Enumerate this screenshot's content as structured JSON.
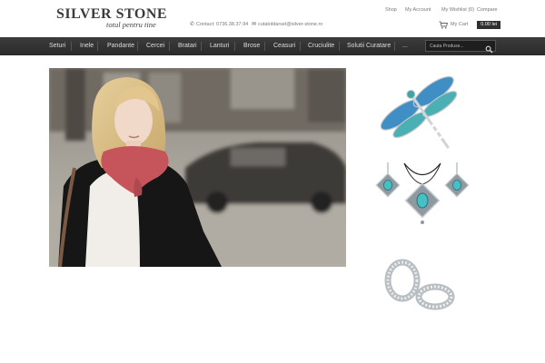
{
  "brand": {
    "name": "SILVER STONE",
    "tagline": "totul pentru tine"
  },
  "header": {
    "contact_phone": "Contact: 0736.38.37.94",
    "contact_email": "cutatoldarsel@silver-stone.ro",
    "top_links": [
      "Shop",
      "My Account",
      "My Wishlist (0)",
      "Compare"
    ],
    "cart_label": "My Cart",
    "cart_total": "0.00 lei"
  },
  "nav": {
    "items": [
      "Seturi",
      "Inele",
      "Pandante",
      "Cercei",
      "Bratari",
      "Lanturi",
      "Brose",
      "Ceasuri",
      "Cruciulite",
      "Solutii Curatare",
      "..."
    ],
    "search_placeholder": "Cauta Produse..."
  },
  "colors": {
    "nav_bg": "#333333",
    "cart_total_bg": "#2f2f2f",
    "scarf": "#c5555a",
    "enamel_blue": "#3f8fc4",
    "turquoise": "#45c1c6"
  },
  "icons": {
    "phone": "phone-icon",
    "email": "envelope-icon",
    "cart": "shopping-cart-icon",
    "search": "search-icon"
  }
}
